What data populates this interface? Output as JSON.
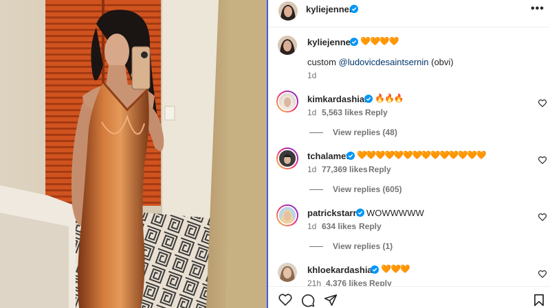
{
  "post": {
    "author": "kyliejenner",
    "more_icon": "more-horizontal-icon",
    "caption": {
      "username": "kyliejenner",
      "emoji": "🧡🧡🧡🧡",
      "text_prefix": "custom ",
      "mention": "@ludovicdesaintsernin",
      "text_suffix": " (obvi)",
      "time": "1d"
    }
  },
  "comments": [
    {
      "username": "kimkardashian",
      "text": "🔥🔥🔥",
      "time": "1d",
      "likes": "5,563 likes",
      "reply": "Reply",
      "view_replies": "View replies (48)"
    },
    {
      "username": "tchalamet",
      "text": "🧡🧡🧡🧡🧡🧡🧡🧡🧡🧡🧡🧡🧡🧡",
      "time": "1d",
      "likes": "77,369 likes",
      "reply": "Reply",
      "view_replies": "View replies (605)"
    },
    {
      "username": "patrickstarrr",
      "text": "WOWWWWW",
      "time": "1d",
      "likes": "634 likes",
      "reply": "Reply",
      "view_replies": "View replies (1)"
    },
    {
      "username": "khloekardashian",
      "text": "🧡🧡🧡",
      "time": "21h",
      "likes": "4,376 likes",
      "reply": "Reply"
    }
  ],
  "actions": {
    "like_icon": "heart-icon",
    "comment_icon": "comment-icon",
    "share_icon": "share-icon",
    "save_icon": "bookmark-icon"
  },
  "colors": {
    "verified_blue": "#0095f6",
    "panel_border": "#3d5af1",
    "dress": "#c0652e"
  }
}
